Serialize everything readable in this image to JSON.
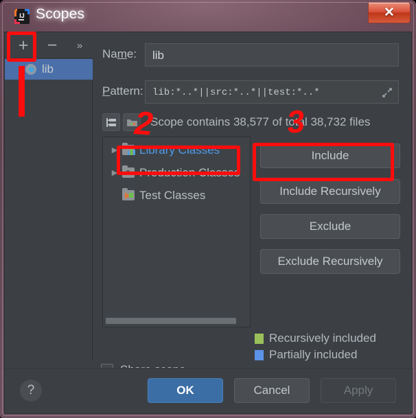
{
  "window": {
    "title": "Scopes",
    "app_icon": "intellij-idea-icon",
    "close_label": "✕"
  },
  "scope_toolbar": {
    "add_label": "+",
    "remove_label": "−",
    "more_label": "»"
  },
  "scope_list": {
    "items": [
      {
        "label": "lib",
        "icon": "scope-circle-icon",
        "selected": true
      }
    ]
  },
  "fields": {
    "name": {
      "label_before": "Na",
      "label_mnemonic": "m",
      "label_after": "e:",
      "value": "lib"
    },
    "pattern": {
      "label_mnemonic": "P",
      "label_after": "attern:",
      "value": "lib:*..*||src:*..*||test:*..*",
      "expand_icon": "expand-diagonal-icon"
    }
  },
  "contains": {
    "icon_flatten": "flatten-packages-icon",
    "icon_compact": "compact-folders-icon",
    "text": "Scope contains 38,577 of total 38,732 files",
    "included_files": "38,577",
    "total_files": "38,732"
  },
  "tree": {
    "rows": [
      {
        "label": "Library Classes",
        "arrow": "▶",
        "icon": "library-classes-icon",
        "selected": true
      },
      {
        "label": "Production Classes",
        "arrow": "▶",
        "icon": "production-classes-icon",
        "selected": false
      },
      {
        "label": "Test Classes",
        "arrow": "",
        "icon": "test-classes-icon",
        "selected": false
      }
    ]
  },
  "actions": {
    "include": "Include",
    "include_recursively": "Include Recursively",
    "exclude": "Exclude",
    "exclude_recursively": "Exclude Recursively"
  },
  "legend": [
    {
      "label": "Recursively included",
      "color": "#9ac05a"
    },
    {
      "label": "Partially included",
      "color": "#5c93e8"
    }
  ],
  "share": {
    "label": "Share scope",
    "checked": false
  },
  "footer": {
    "help_label": "?",
    "ok_label": "OK",
    "cancel_label": "Cancel",
    "apply_label": "Apply"
  },
  "annotations": {
    "number_2": "2",
    "number_3": "3",
    "color": "#fb0d0d"
  }
}
